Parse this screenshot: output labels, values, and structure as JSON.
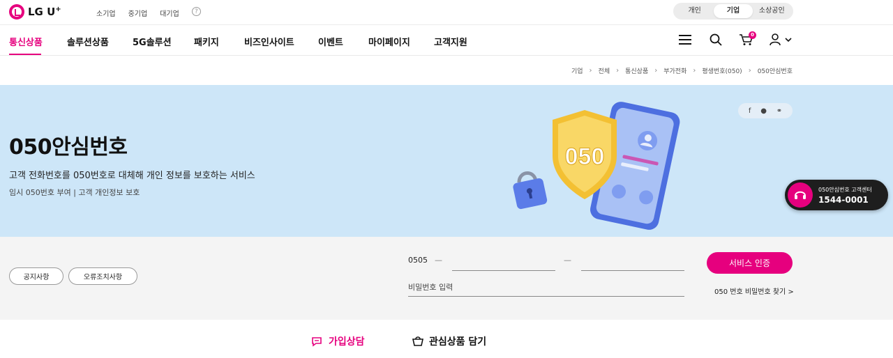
{
  "brand": {
    "logo_text": "LG U",
    "logo_plus": "+"
  },
  "segments": {
    "links": [
      "소기업",
      "중기업",
      "대기업"
    ],
    "help": "?"
  },
  "user_toggle": {
    "options": [
      "개인",
      "기업",
      "소상공인"
    ],
    "active": "기업"
  },
  "gnb": {
    "items": [
      "통신상품",
      "솔루션상품",
      "5G솔루션",
      "패키지",
      "비즈인사이트",
      "이벤트",
      "마이페이지",
      "고객지원"
    ],
    "active": "통신상품"
  },
  "cart": {
    "count": "0"
  },
  "breadcrumb": [
    "기업",
    "전체",
    "통신상품",
    "부가전화",
    "평생번호(050)",
    "050안심번호"
  ],
  "hero": {
    "title": "050안심번호",
    "description": "고객 전화번호를 050번호로 대체해 개인 정보를 보호하는 서비스",
    "sub": "임시 050번호 부여 | 고객 개인정보 보호",
    "illust_badge": "050"
  },
  "cs_center": {
    "label": "050안심번호 고객센터",
    "phone": "1544-0001"
  },
  "auth": {
    "notice_btn": "공지사항",
    "error_btn": "오류조치사항",
    "prefix": "0505",
    "dash": "—",
    "password_placeholder": "비밀번호 입력",
    "service_btn": "서비스 인증",
    "find_link": "050 번호 비밀번호 찾기 >"
  },
  "bottom_tabs": {
    "consult": "가입상담",
    "wishlist": "관심상품 담기"
  },
  "colors": {
    "accent": "#e6007e",
    "hero_bg": "#cde6f8",
    "auth_bg": "#f4f4f4"
  }
}
